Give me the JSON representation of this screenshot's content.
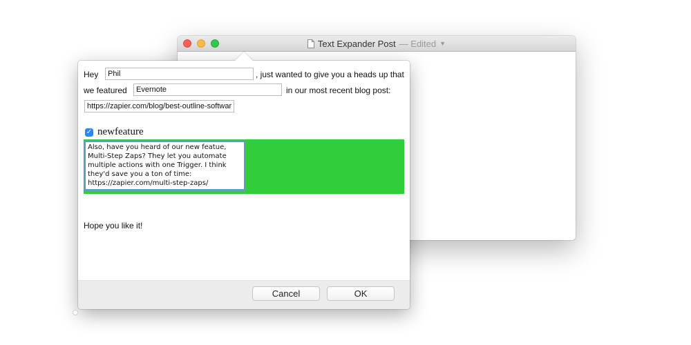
{
  "window": {
    "title": "Text Expander Post",
    "title_suffix": "— Edited",
    "icons": [
      "document-icon",
      "chevron-down-icon"
    ]
  },
  "form": {
    "line1_prefix": "Hey",
    "name_value": "Phil",
    "line1_suffix": ", just wanted to give you a heads up that",
    "line2_prefix": "we featured",
    "product_value": "Evernote",
    "line2_suffix": "in our most recent blog post:",
    "url_value": "https://zapier.com/blog/best-outline-software/",
    "checkbox_label": "newfeature",
    "checkbox_checked": true,
    "body_text": "Also, have you heard of our new featue, Multi-Step Zaps? They let you automate multiple actions with one Trigger. I think they'd save you a ton of time: https://zapier.com/multi-step-zaps/",
    "closing": "Hope you like it!"
  },
  "buttons": {
    "cancel_label": "Cancel",
    "ok_label": "OK"
  },
  "colors": {
    "highlight": "#31cd3a",
    "checkbox": "#2f86f6",
    "close": "#fc605c",
    "minimize": "#fdbc40",
    "maximize": "#34c84a"
  }
}
